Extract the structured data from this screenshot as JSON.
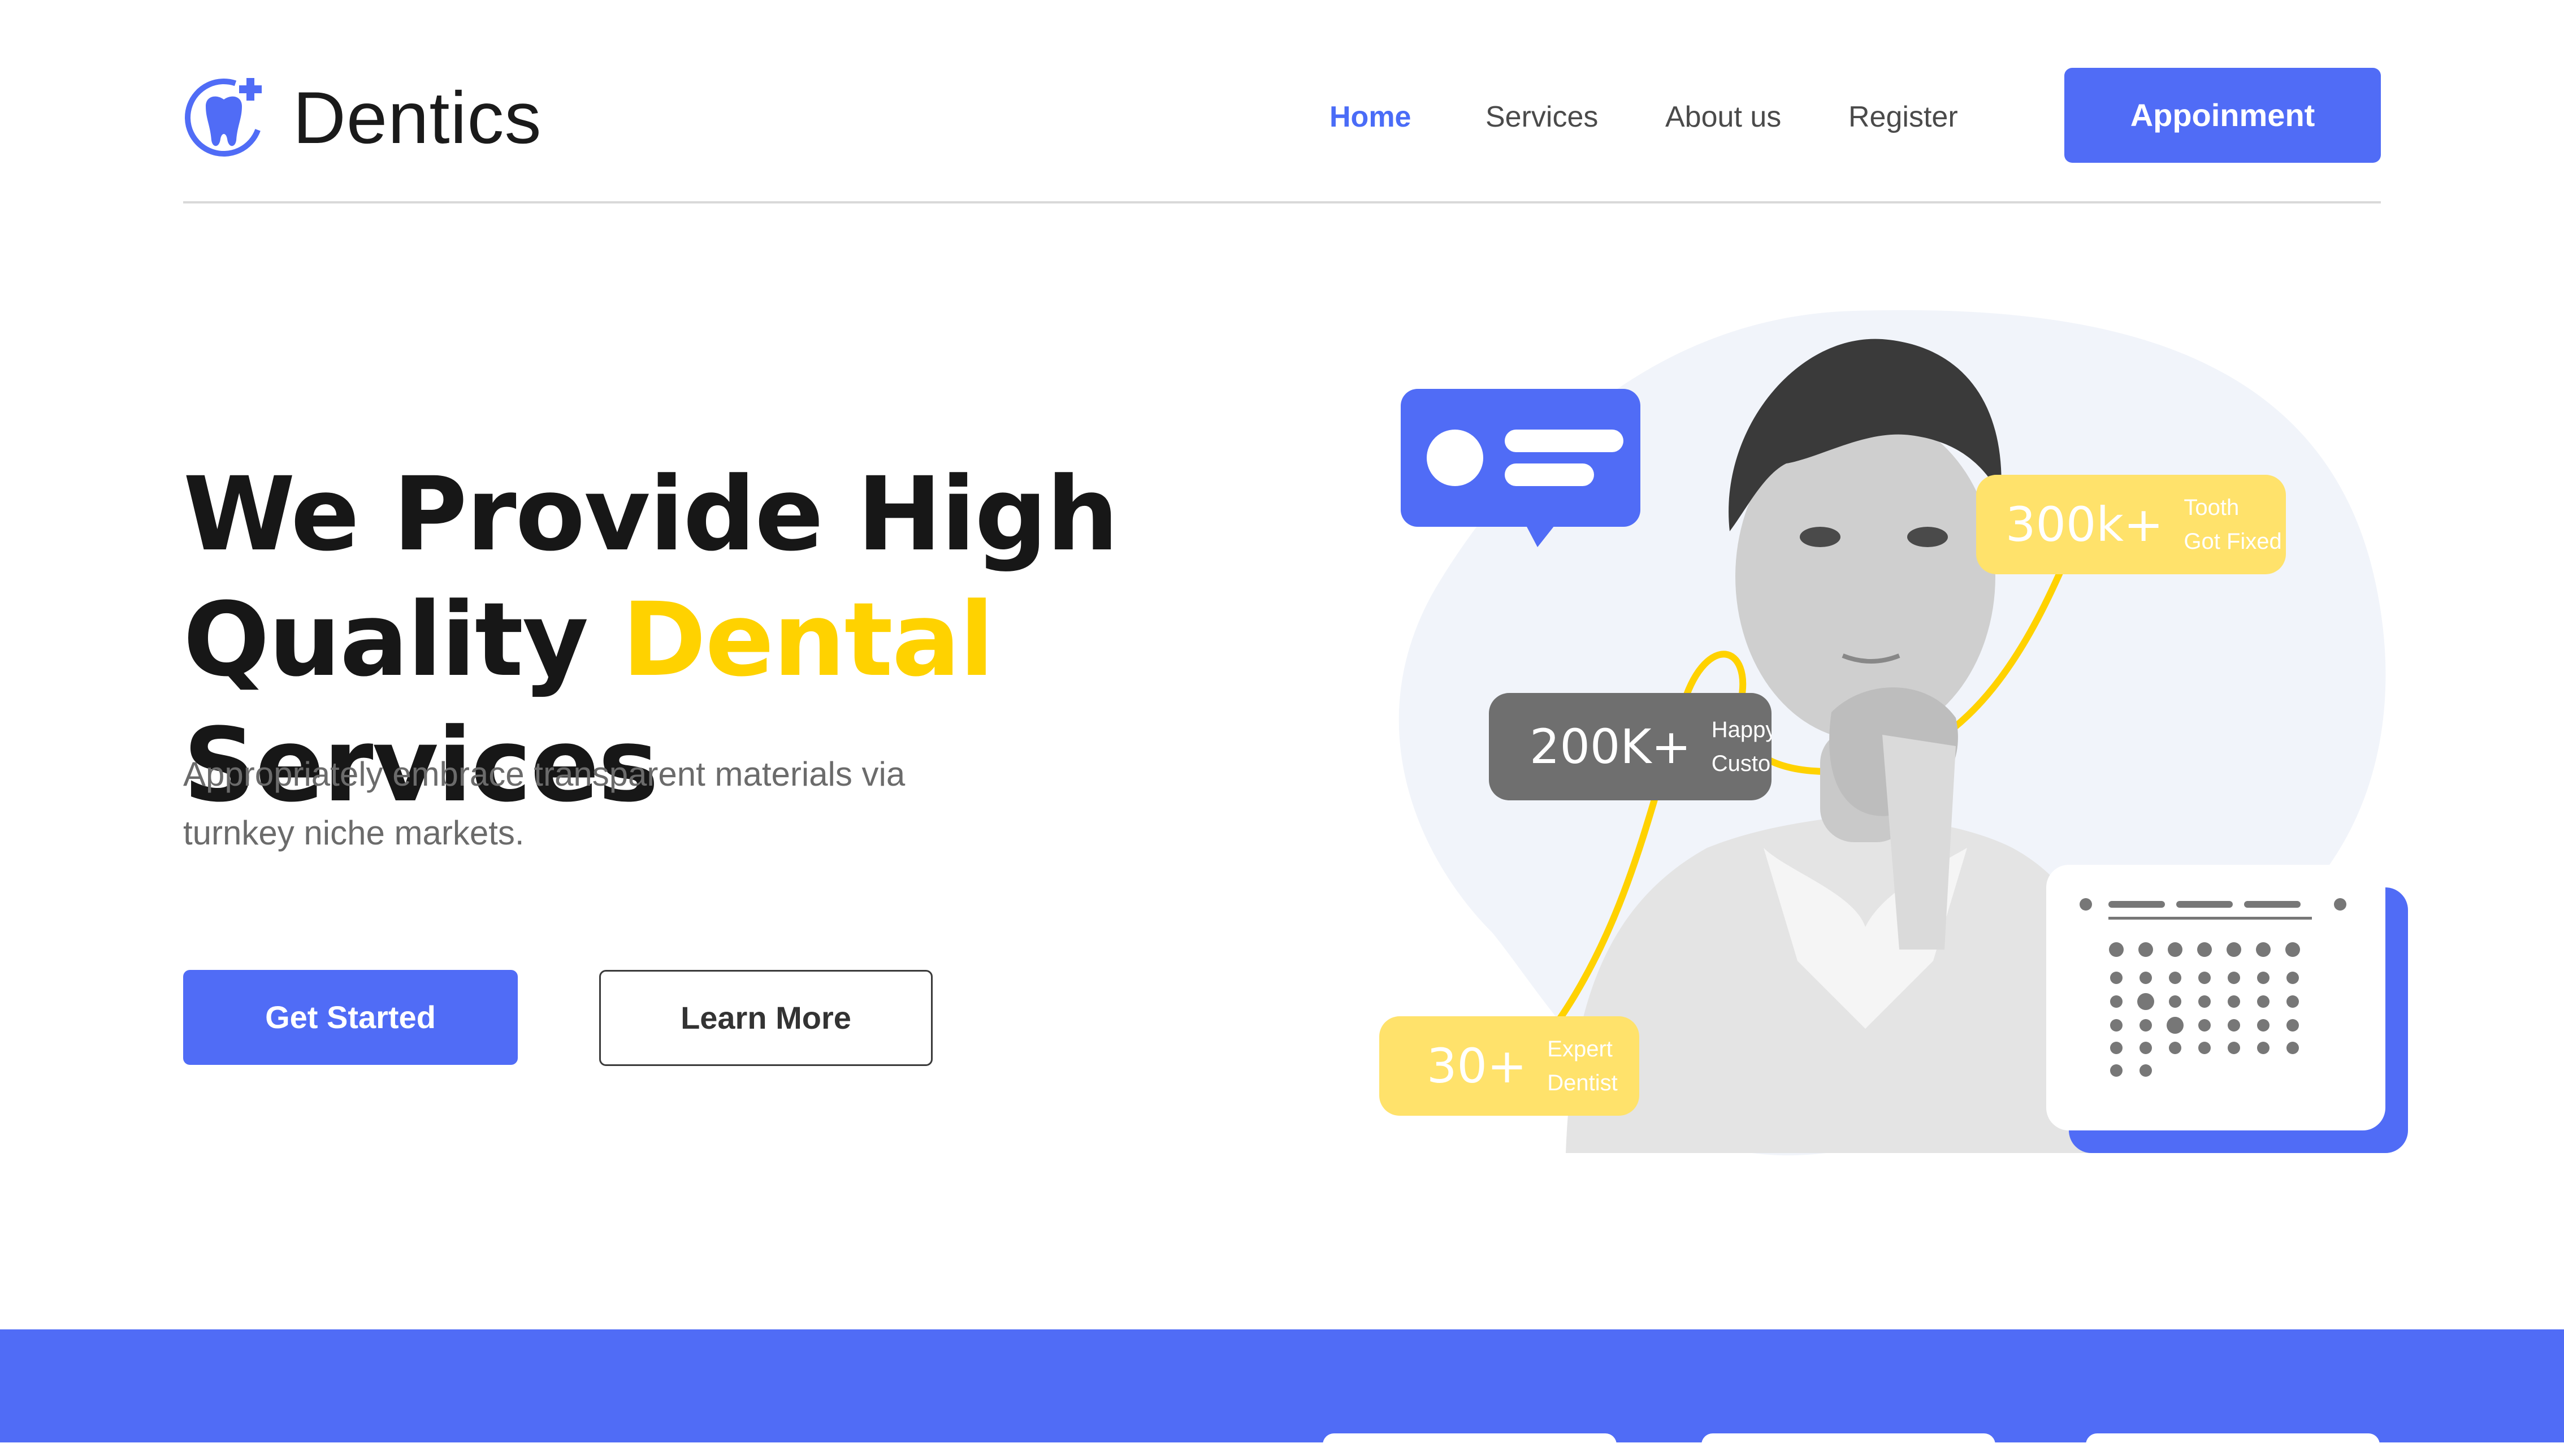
{
  "brand": {
    "name": "Dentics",
    "accent": "#506cf6",
    "highlight": "#ffd200"
  },
  "nav": {
    "links": [
      {
        "label": "Home",
        "active": true
      },
      {
        "label": "Services",
        "active": false
      },
      {
        "label": "About us",
        "active": false
      },
      {
        "label": "Register",
        "active": false
      }
    ],
    "cta": "Appoinment"
  },
  "hero": {
    "title_line1": "We Provide High",
    "title_line2_pre": "Quality ",
    "title_line2_highlight": "Dental",
    "title_line2_post": " Services",
    "description_line1": "Appropriately embrace transparent materials via",
    "description_line2": "turnkey niche markets.",
    "primary_button": "Get Started",
    "secondary_button": "Learn More"
  },
  "stats": [
    {
      "value": "300k+",
      "label_line1": "Tooth",
      "label_line2": "Got Fixed"
    },
    {
      "value": "200K+",
      "label_line1": "Happy",
      "label_line2": "Custom"
    },
    {
      "value": "30+",
      "label_line1": "Expert",
      "label_line2": "Dentist"
    }
  ],
  "icons": [
    "tooth-plus-icon",
    "chat-bubble-icon",
    "calendar-icon"
  ]
}
